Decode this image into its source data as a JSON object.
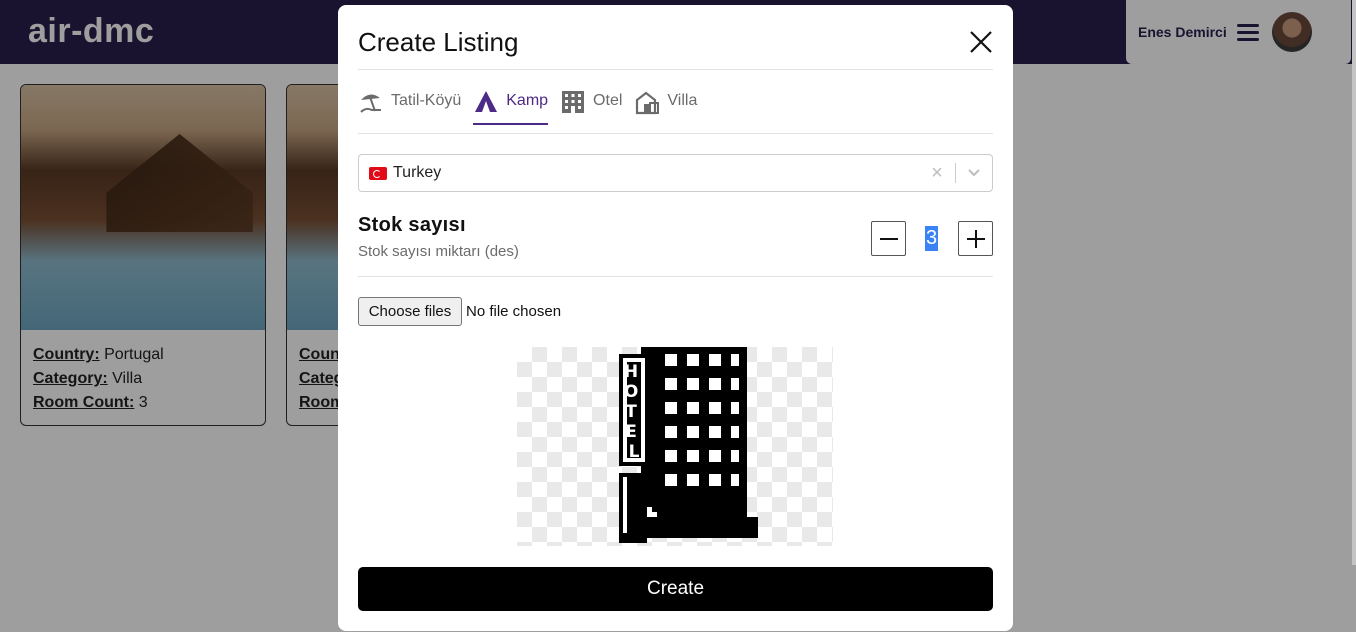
{
  "app": {
    "logo": "air-dmc"
  },
  "user": {
    "name": "Enes Demirci"
  },
  "cards": [
    {
      "country_label": "Country:",
      "country": "Portugal",
      "category_label": "Category:",
      "category": "Villa",
      "rooms_label": "Room Count:",
      "rooms": "3"
    },
    {
      "country_label": "Coun",
      "category_label": "Categ",
      "rooms_label": "Room"
    }
  ],
  "modal": {
    "title": "Create Listing",
    "tabs": [
      {
        "label": "Tatil-Köyü",
        "icon": "beach-umbrella-icon",
        "active": false
      },
      {
        "label": "Kamp",
        "icon": "tent-icon",
        "active": true
      },
      {
        "label": "Otel",
        "icon": "building-icon",
        "active": false
      },
      {
        "label": "Villa",
        "icon": "house-icon",
        "active": false
      }
    ],
    "country_select": {
      "value": "Turkey",
      "flag": "turkey-flag-icon"
    },
    "stock": {
      "title": "Stok sayısı",
      "subtitle": "Stok sayısı miktarı (des)",
      "value": "3"
    },
    "file_input": {
      "button_label": "Choose files",
      "status": "No file chosen"
    },
    "preview": {
      "sign_text": "HOTEL"
    },
    "create_label": "Create"
  },
  "colors": {
    "accent": "#4c2a85",
    "navbar": "#2a1f4e",
    "button": "#000000",
    "selection": "#3a83f7"
  }
}
